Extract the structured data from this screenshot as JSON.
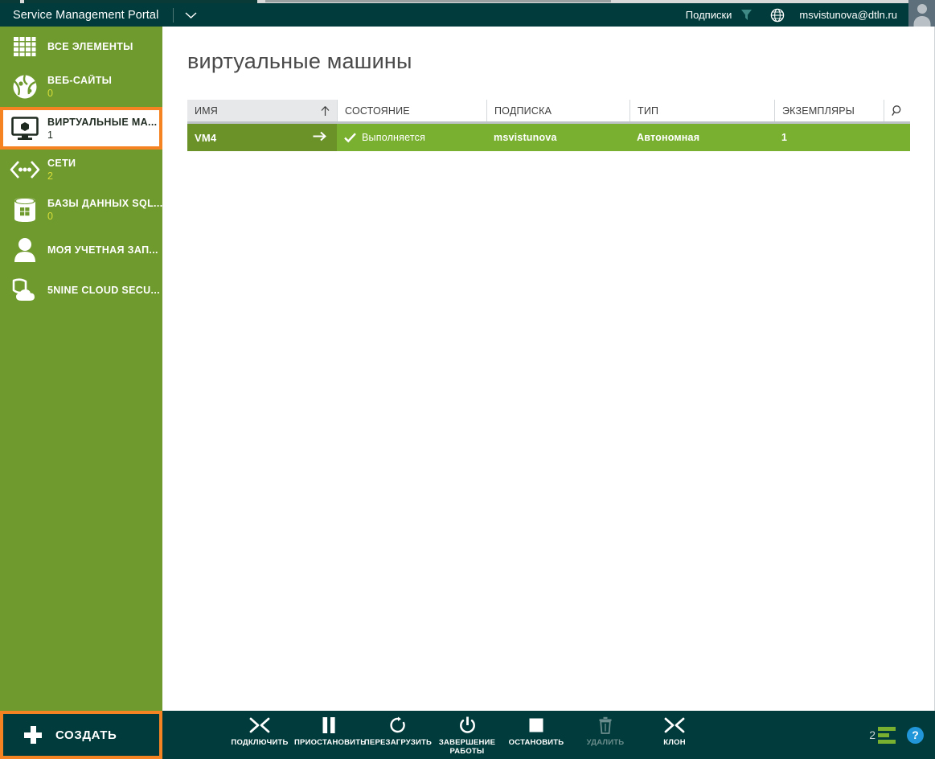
{
  "header": {
    "title": "Service Management Portal",
    "chevron_icon": "chevron-down-icon",
    "subscriptions_label": "Подписки",
    "subscriptions_icon": "filter-icon",
    "globe_icon": "globe-icon",
    "user_email": "msvistunova@dtln.ru",
    "avatar_icon": "user-avatar"
  },
  "sidebar": {
    "background_color": "#6f9a2e",
    "selection_border_color": "#f58322",
    "count_color": "#d6dd3a",
    "items": [
      {
        "label": "ВСЕ ЭЛЕМЕНТЫ",
        "count": "",
        "icon": "grid-icon",
        "selected": false
      },
      {
        "label": "ВЕБ-САЙТЫ",
        "count": "0",
        "icon": "globe-web-icon",
        "selected": false
      },
      {
        "label": "ВИРТУАЛЬНЫЕ МА...",
        "count": "1",
        "icon": "virtual-machine-icon",
        "selected": true
      },
      {
        "label": "СЕТИ",
        "count": "2",
        "icon": "network-icon",
        "selected": false
      },
      {
        "label": "БАЗЫ ДАННЫХ SQL...",
        "count": "0",
        "icon": "sql-database-icon",
        "selected": false
      },
      {
        "label": "МОЯ УЧЕТНАЯ ЗАП...",
        "count": "",
        "icon": "person-icon",
        "selected": false
      },
      {
        "label": "5NINE CLOUD SECU...",
        "count": "",
        "icon": "shield-cloud-icon",
        "selected": false
      }
    ]
  },
  "main": {
    "page_title": "виртуальные машины",
    "table": {
      "columns": [
        {
          "key": "name",
          "label": "ИМЯ",
          "sorted": true,
          "sort_icon": "sort-ascending-icon"
        },
        {
          "key": "state",
          "label": "СОСТОЯНИЕ",
          "sorted": false
        },
        {
          "key": "subscription",
          "label": "ПОДПИСКА",
          "sorted": false
        },
        {
          "key": "type",
          "label": "ТИП",
          "sorted": false
        },
        {
          "key": "instances",
          "label": "ЭКЗЕМПЛЯРЫ",
          "sorted": false
        }
      ],
      "search_icon": "search-icon",
      "rows": [
        {
          "name": "VM4",
          "state": "Выполняется",
          "state_icon": "checkmark-icon",
          "subscription": "msvistunova",
          "type": "Автономная",
          "instances": "1",
          "selected": true,
          "row_arrow_icon": "arrow-right-icon"
        }
      ]
    }
  },
  "commandbar": {
    "background_color": "#013b3b",
    "create_button": {
      "label": "СОЗДАТЬ",
      "icon": "plus-icon",
      "highlighted": true
    },
    "commands": [
      {
        "label": "ПОДКЛЮЧИТЬ",
        "icon": "connect-icon",
        "disabled": false
      },
      {
        "label": "ПРИОСТАНОВИТЬ",
        "icon": "pause-icon",
        "disabled": false
      },
      {
        "label": "ПЕРЕЗАГРУЗИТЬ",
        "icon": "restart-icon",
        "disabled": false
      },
      {
        "label": "ЗАВЕРШЕНИЕ РАБОТЫ",
        "icon": "power-icon",
        "disabled": false
      },
      {
        "label": "ОСТАНОВИТЬ",
        "icon": "stop-icon",
        "disabled": false
      },
      {
        "label": "УДАЛИТЬ",
        "icon": "trash-icon",
        "disabled": true
      },
      {
        "label": "КЛОН",
        "icon": "clone-icon",
        "disabled": false
      }
    ],
    "log_count": "2",
    "log_icon": "activity-log-icon",
    "help_icon": "help-icon",
    "help_label": "?"
  }
}
